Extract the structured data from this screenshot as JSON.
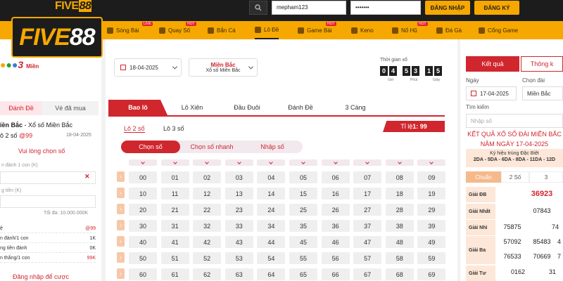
{
  "header": {
    "logo_text": "FIVE88",
    "username_value": "mepham123",
    "password_value": "•••••••",
    "login_label": "ĐĂNG NHẬP",
    "register_label": "ĐĂNG KÝ"
  },
  "nav": [
    {
      "label": "Sòng Bài",
      "badge": "LIVE"
    },
    {
      "label": "Quay Số",
      "badge": "HOT"
    },
    {
      "label": "Bắn Cá",
      "badge": ""
    },
    {
      "label": "Lô Đề",
      "badge": ""
    },
    {
      "label": "Game Bài",
      "badge": "HOT"
    },
    {
      "label": "Keno",
      "badge": ""
    },
    {
      "label": "Nổ Hũ",
      "badge": "HOT"
    },
    {
      "label": "Đá Gà",
      "badge": ""
    },
    {
      "label": "Cổng Game",
      "badge": ""
    }
  ],
  "lottery": {
    "brand_text": "3",
    "brand_sub": "Miền",
    "date": "18-04-2025",
    "region_title": "Miền Bắc",
    "region_sub": "Xổ số Miền Bắc",
    "timer_label": "Thời gian xổ",
    "timer_digits": [
      "0",
      "4",
      "5",
      "3",
      "1",
      "5"
    ],
    "timer_units": [
      "Giờ",
      "Phút",
      "Giây"
    ]
  },
  "tabs": [
    "Bao lô",
    "Lô Xiên",
    "Đầu Đuôi",
    "Đánh Đề",
    "3 Càng"
  ],
  "subtabs": [
    "Lô 2 số",
    "Lô 3 số"
  ],
  "rate": {
    "prefix": "Tỉ lệ ",
    "value": "1: 99"
  },
  "pills": [
    "Chọn số",
    "Chọn số nhanh",
    "Nhập số"
  ],
  "numbers": [
    [
      "00",
      "01",
      "02",
      "03",
      "04",
      "05",
      "06",
      "07",
      "08",
      "09"
    ],
    [
      "10",
      "11",
      "12",
      "13",
      "14",
      "15",
      "16",
      "17",
      "18",
      "19"
    ],
    [
      "20",
      "21",
      "22",
      "23",
      "24",
      "25",
      "26",
      "27",
      "28",
      "29"
    ],
    [
      "30",
      "31",
      "32",
      "33",
      "34",
      "35",
      "36",
      "37",
      "38",
      "39"
    ],
    [
      "40",
      "41",
      "42",
      "43",
      "44",
      "45",
      "46",
      "47",
      "48",
      "49"
    ],
    [
      "50",
      "51",
      "52",
      "53",
      "54",
      "55",
      "56",
      "57",
      "58",
      "59"
    ],
    [
      "60",
      "61",
      "62",
      "63",
      "64",
      "65",
      "66",
      "67",
      "68",
      "69"
    ]
  ],
  "left": {
    "tab_active": "Đánh Đề",
    "tab_other": "Vé đã mua",
    "title_bold": "iền Bắc",
    "title_rest": " - Xổ số Miền Bắc",
    "game_prefix": "ô 2 số ",
    "game_rate": "@99",
    "game_date": "18-04-2025",
    "select_prompt": "Vui lòng chọn số",
    "field1_hint": "n đánh 1 con (K)",
    "field2_hint": "g tiền (K)",
    "max_note": "Tối đa: 10.000.000K",
    "rows": [
      {
        "label": "ệ",
        "value": "@99",
        "red": true
      },
      {
        "label": "n đánh/1 con",
        "value": "1K",
        "red": false
      },
      {
        "label": "ng tiền đánh",
        "value": "0K",
        "red": false
      },
      {
        "label": "n thắng/1 con",
        "value": "99K",
        "red": true
      }
    ],
    "login_note": "Đăng nhập để cược"
  },
  "right": {
    "tab_active": "Kết quả",
    "tab_other": "Thông k",
    "day_label": "Ngày",
    "day_value": "17-04-2025",
    "pick_label": "Chọn đài",
    "pick_value": "Miền Bắc",
    "search_label": "Tìm kiếm",
    "search_placeholder": "Nhập số",
    "title_line1": "KẾT QUẢ XỔ SỐ ĐÀI MIỀN BẮC",
    "title_line2": "NĂM NGÀY 17-04-2025",
    "sign_label": "Ký hiệu trúng Đặc Biệt",
    "sign_value": "2DA - 5DA - 6DA - 8DA - 11DA - 12D",
    "sub_tabs": [
      "Chuẩn",
      "2 Số",
      "3"
    ],
    "prizes": [
      {
        "label": "Giải ĐB",
        "values": [
          "36923"
        ]
      },
      {
        "label": "Giải Nhất",
        "values": [
          "07843"
        ]
      },
      {
        "label": "Giải Nhì",
        "values": [
          "75875",
          "74"
        ]
      },
      {
        "label": "Giải Ba",
        "values": [
          "57092",
          "85483",
          "4",
          "76533",
          "70669",
          "7"
        ]
      },
      {
        "label": "Giải Tư",
        "values": [
          "0162",
          "31"
        ]
      }
    ],
    "colors": {
      "red": "#d0262e",
      "amber": "#f6a800"
    }
  }
}
